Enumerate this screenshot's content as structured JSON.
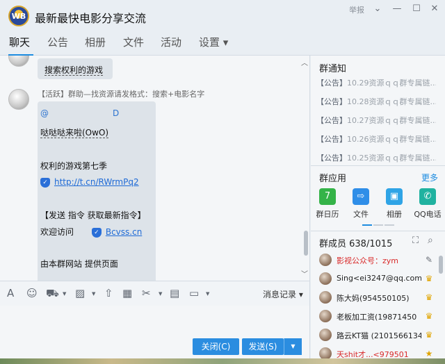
{
  "window": {
    "logo_text": "WB",
    "title": "最新最快电影分享交流",
    "report_label": "举报",
    "controls": {
      "dropdown": "⌄",
      "minimize": "—",
      "maximize": "☐",
      "close": "✕"
    }
  },
  "tabs": [
    {
      "label": "聊天",
      "active": true
    },
    {
      "label": "公告"
    },
    {
      "label": "相册"
    },
    {
      "label": "文件"
    },
    {
      "label": "活动"
    },
    {
      "label": "设置 ▾"
    }
  ],
  "chat": {
    "msg1": {
      "text": "搜索权利的游戏"
    },
    "msg2": {
      "sender": "【活跃】群助—找资源请发格式：搜索+电影名字",
      "mention_at": "@",
      "mention_d": "D",
      "line1": "哒哒哒来啦(OwO)",
      "line2": "权利的游戏第七季",
      "link1": "http://t.cn/RWrmPq2",
      "line3": "【发送 指令 获取最新指令】",
      "line4_prefix": "欢迎访问",
      "link2": "Bcvss.cn",
      "line5": "由本群网站  提供页面"
    }
  },
  "toolbar": {
    "history_label": "消息记录 ▾",
    "icons": [
      "font-icon",
      "emoji-icon",
      "gift-icon",
      "image-icon",
      "upload-icon",
      "calendar-icon",
      "scissors-icon",
      "box-icon",
      "screen-share-icon"
    ]
  },
  "buttons": {
    "close_label": "关闭(C)",
    "send_label": "发送(S)",
    "send_dropdown": "▼"
  },
  "right": {
    "notice_title": "群通知",
    "notices": [
      {
        "tag": "【公告】",
        "text": "10.29资源ｑｑ群专属链..."
      },
      {
        "tag": "【公告】",
        "text": "10.28资源ｑｑ群专属链..."
      },
      {
        "tag": "【公告】",
        "text": "10.27资源ｑｑ群专属链..."
      },
      {
        "tag": "【公告】",
        "text": "10.26资源ｑｑ群专属链..."
      },
      {
        "tag": "【公告】",
        "text": "10.25资源ｑｑ群专属链..."
      }
    ],
    "apps_title": "群应用",
    "apps_more": "更多",
    "apps": [
      {
        "label": "群日历",
        "glyph": "7",
        "color": "#34b348"
      },
      {
        "label": "文件",
        "glyph": "⇨",
        "color": "#2f8ee8"
      },
      {
        "label": "相册",
        "glyph": "▣",
        "color": "#2fa4e6"
      },
      {
        "label": "QQ电话",
        "glyph": "✆",
        "color": "#20b2a0"
      }
    ],
    "members_title": "群成员 638/1015",
    "members": [
      {
        "name": "影视公众号：zym",
        "red": true,
        "role": "✎"
      },
      {
        "name": "Sing<ei3247@qq.com>",
        "red": false,
        "role": "♛"
      },
      {
        "name": "陈大妈(954550105)",
        "red": false,
        "role": "♛"
      },
      {
        "name": "老板加工资(19871450",
        "red": false,
        "role": "♛"
      },
      {
        "name": "路云KT猫  (2101566134)",
        "red": false,
        "role": "♛"
      },
      {
        "name": "天shit才...<979501",
        "red": true,
        "role": "★"
      }
    ]
  },
  "colors": {
    "accent": "#2b8de0",
    "notice_text": "#9aa1a9",
    "member_red": "#d92a2a"
  }
}
